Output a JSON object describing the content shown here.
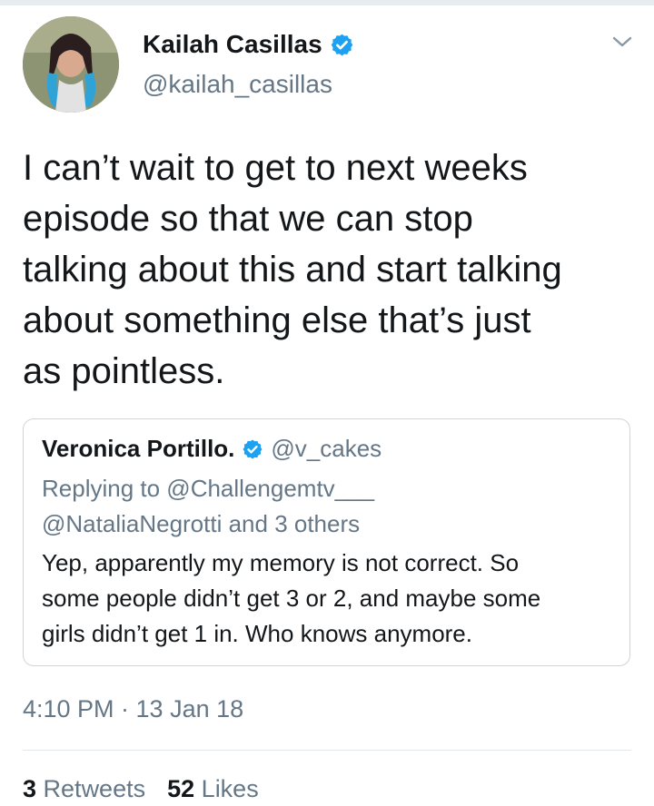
{
  "tweet": {
    "author": {
      "display_name": "Kailah Casillas",
      "handle": "@kailah_casillas",
      "verified": true
    },
    "text": "I can’t wait to get to next weeks\nepisode so that we can stop\ntalking about this and start talking\nabout something else that’s just\nas pointless.",
    "timestamp": "4:10 PM · 13 Jan 18",
    "stats": {
      "retweets_count": "3",
      "retweets_label": "Retweets",
      "likes_count": "52",
      "likes_label": "Likes"
    }
  },
  "quoted_tweet": {
    "author": {
      "display_name": "Veronica Portillo.",
      "handle": "@v_cakes",
      "verified": true
    },
    "replying_to_line1": "Replying to @Challengemtv___",
    "replying_to_line2": "@NataliaNegrotti and 3 others",
    "text": "Yep, apparently my memory is not correct.  So\nsome people didn’t get 3 or 2, and maybe some\ngirls didn’t get 1 in. Who knows anymore."
  },
  "icons": {
    "verified": "verified-badge-icon",
    "menu": "chevron-down-icon"
  },
  "colors": {
    "text_primary": "#14171a",
    "text_secondary": "#657786",
    "verified_blue": "#1da1f2",
    "border": "#ccd6dd"
  }
}
